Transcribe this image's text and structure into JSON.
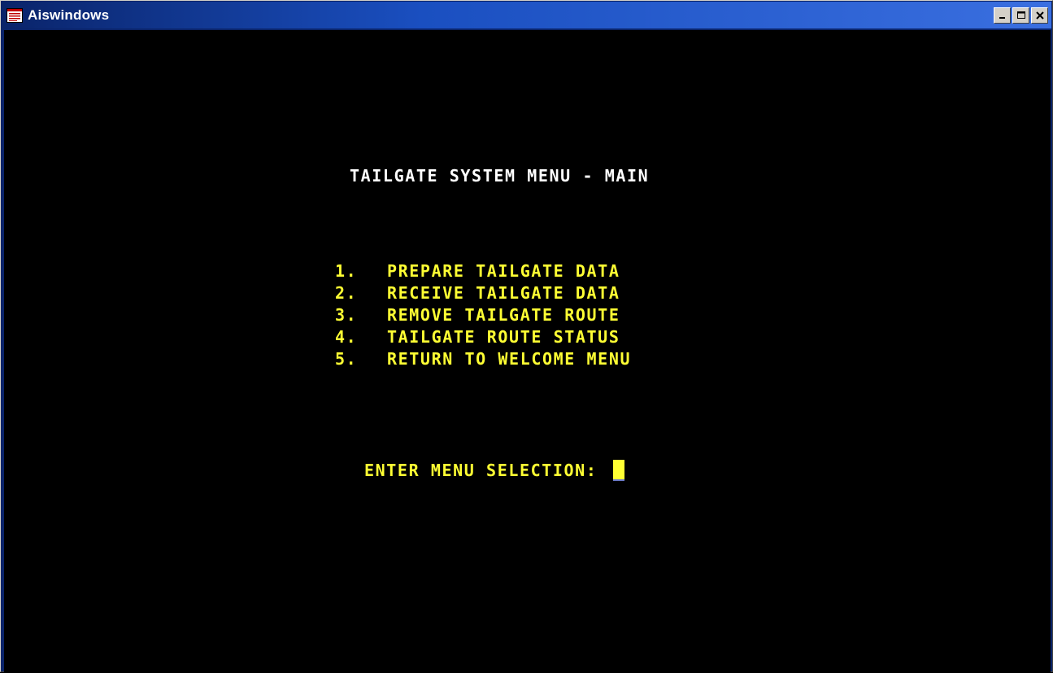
{
  "window": {
    "title": "Aiswindows",
    "icon": "app-window-icon",
    "controls": {
      "minimize_icon": "minimize-icon",
      "maximize_icon": "maximize-icon",
      "close_icon": "close-icon"
    }
  },
  "terminal": {
    "background": "#000000",
    "title_color": "#ffffff",
    "text_color": "#ffff33",
    "menu_title": "TAILGATE SYSTEM MENU - MAIN",
    "menu_items": [
      {
        "num": "1.",
        "label": "PREPARE TAILGATE DATA"
      },
      {
        "num": "2.",
        "label": "RECEIVE TAILGATE DATA"
      },
      {
        "num": "3.",
        "label": "REMOVE TAILGATE ROUTE"
      },
      {
        "num": "4.",
        "label": "TAILGATE ROUTE STATUS"
      },
      {
        "num": "5.",
        "label": "RETURN TO WELCOME MENU"
      }
    ],
    "prompt_label": "ENTER MENU SELECTION:",
    "selection_value": ""
  }
}
